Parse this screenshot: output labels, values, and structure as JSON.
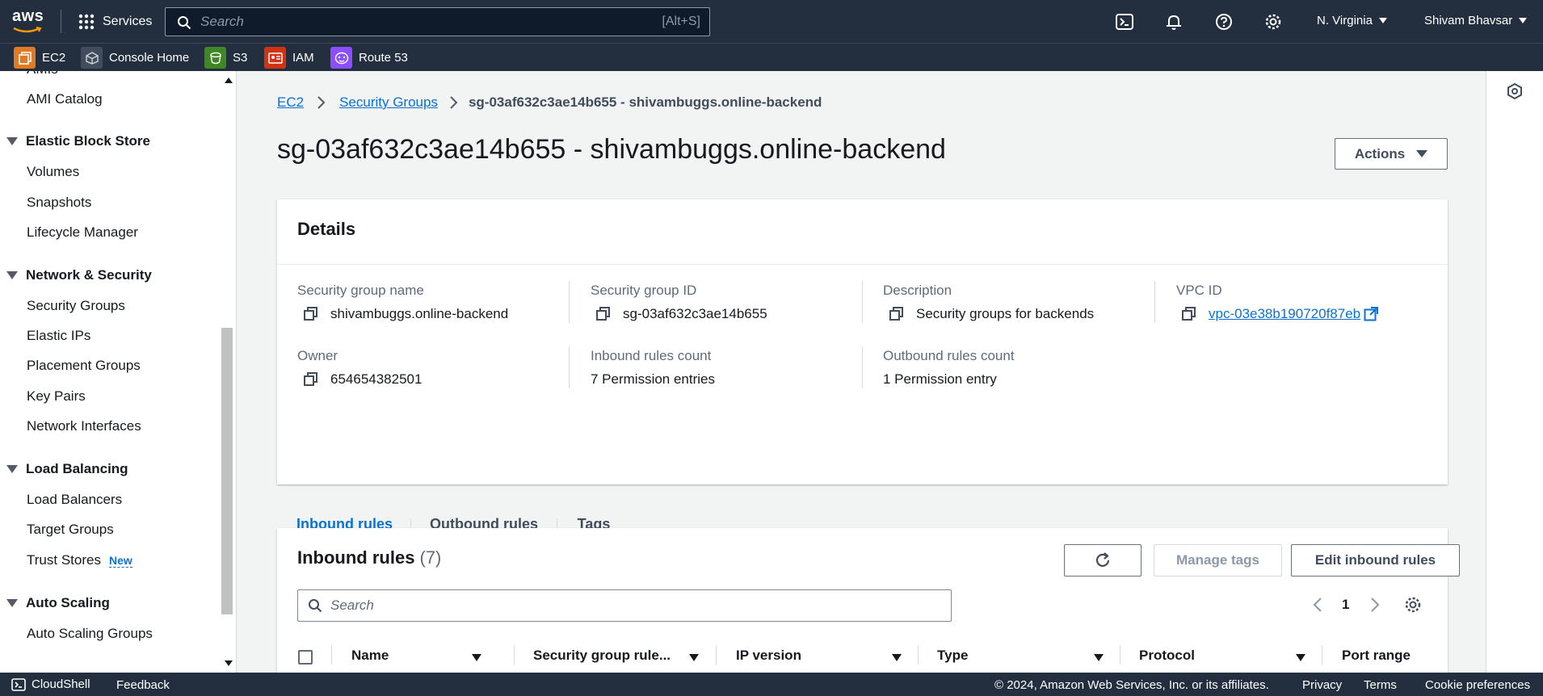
{
  "topnav": {
    "logo": "aws",
    "services_label": "Services",
    "search_placeholder": "Search",
    "search_shortcut": "[Alt+S]",
    "region": "N. Virginia",
    "user": "Shivam Bhavsar",
    "icons": [
      "grid-icon",
      "search-icon",
      "cloudshell-icon",
      "bell-icon",
      "help-icon",
      "gear-icon"
    ]
  },
  "favorites": [
    {
      "label": "EC2",
      "color": "#e07b24"
    },
    {
      "label": "Console Home",
      "color": "#414d5c"
    },
    {
      "label": "S3",
      "color": "#3f8624"
    },
    {
      "label": "IAM",
      "color": "#d13212"
    },
    {
      "label": "Route 53",
      "color": "#8c4fff"
    }
  ],
  "sidebar": {
    "partial_top": "AMIs",
    "ami_catalog": "AMI Catalog",
    "ebs": {
      "title": "Elastic Block Store",
      "items": [
        "Volumes",
        "Snapshots",
        "Lifecycle Manager"
      ]
    },
    "netsec": {
      "title": "Network & Security",
      "items": [
        "Security Groups",
        "Elastic IPs",
        "Placement Groups",
        "Key Pairs",
        "Network Interfaces"
      ]
    },
    "lb": {
      "title": "Load Balancing",
      "items": [
        "Load Balancers",
        "Target Groups",
        "Trust Stores"
      ],
      "new_badge": "New"
    },
    "as": {
      "title": "Auto Scaling",
      "items": [
        "Auto Scaling Groups"
      ]
    }
  },
  "breadcrumb": {
    "root": "EC2",
    "section": "Security Groups",
    "current": "sg-03af632c3ae14b655 - shivambuggs.online-backend"
  },
  "page_title": "sg-03af632c3ae14b655 - shivambuggs.online-backend",
  "actions_label": "Actions",
  "details": {
    "title": "Details",
    "sg_name_label": "Security group name",
    "sg_name": "shivambuggs.online-backend",
    "sg_id_label": "Security group ID",
    "sg_id": "sg-03af632c3ae14b655",
    "desc_label": "Description",
    "desc": "Security groups for backends",
    "vpc_label": "VPC ID",
    "vpc": "vpc-03e38b190720f87eb",
    "owner_label": "Owner",
    "owner": "654654382501",
    "inbound_count_label": "Inbound rules count",
    "inbound_count": "7 Permission entries",
    "outbound_count_label": "Outbound rules count",
    "outbound_count": "1 Permission entry"
  },
  "tabs": {
    "inbound": "Inbound rules",
    "outbound": "Outbound rules",
    "tags": "Tags"
  },
  "inbound": {
    "title": "Inbound rules",
    "count": "(7)",
    "manage_tags": "Manage tags",
    "edit": "Edit inbound rules",
    "search_placeholder": "Search",
    "page": "1",
    "columns": [
      "Name",
      "Security group rule...",
      "IP version",
      "Type",
      "Protocol",
      "Port range"
    ]
  },
  "footer": {
    "cloudshell": "CloudShell",
    "feedback": "Feedback",
    "copyright": "© 2024, Amazon Web Services, Inc. or its affiliates.",
    "privacy": "Privacy",
    "terms": "Terms",
    "cookies": "Cookie preferences"
  }
}
